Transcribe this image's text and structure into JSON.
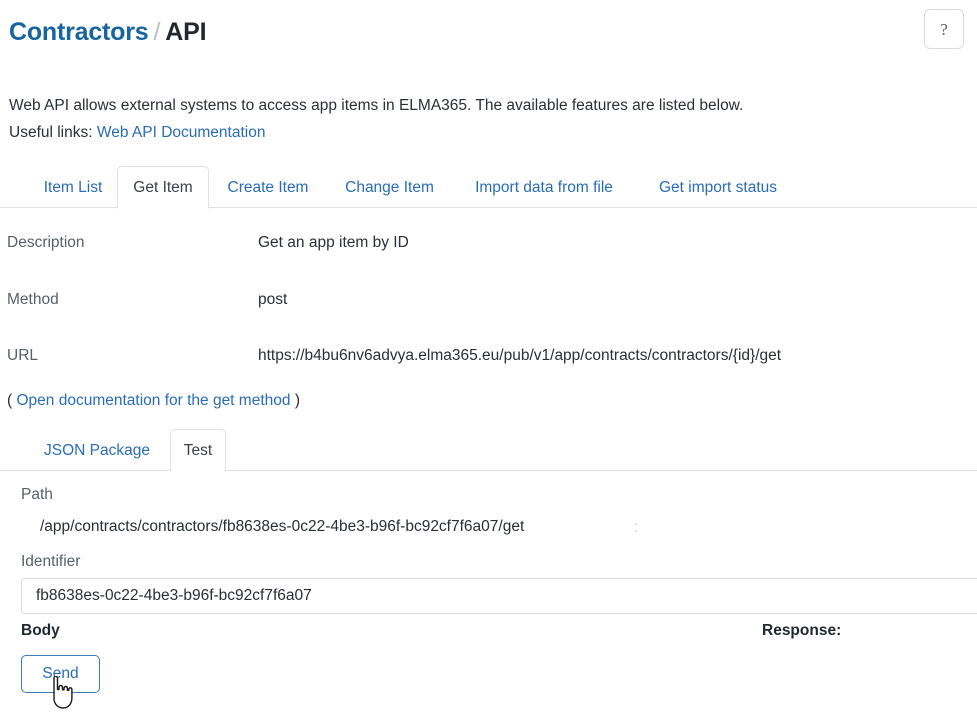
{
  "header": {
    "breadcrumb_parent": "Contractors",
    "breadcrumb_separator": "/",
    "breadcrumb_current": "API",
    "help_glyph": "?"
  },
  "intro": {
    "line1": "Web API allows external systems to access app items in ELMA365. The available features are listed below.",
    "line2_prefix": "Useful links: ",
    "line2_link": "Web API Documentation"
  },
  "primary_tabs": [
    {
      "label": "Item List",
      "active": false
    },
    {
      "label": "Get Item",
      "active": true
    },
    {
      "label": "Create Item",
      "active": false
    },
    {
      "label": "Change Item",
      "active": false
    },
    {
      "label": "Import data from file",
      "active": false
    },
    {
      "label": "Get import status",
      "active": false
    }
  ],
  "details": [
    {
      "label": "Description",
      "value": "Get an app item by ID"
    },
    {
      "label": "Method",
      "value": "post"
    },
    {
      "label": "URL",
      "value": "https://b4bu6nv6advya.elma365.eu/pub/v1/app/contracts/contractors/{id}/get"
    }
  ],
  "doc_link": {
    "open_paren": "(",
    "link": "Open documentation for the get method",
    "close_paren": ")"
  },
  "secondary_tabs": [
    {
      "label": "JSON Package",
      "active": false
    },
    {
      "label": "Test",
      "active": true
    }
  ],
  "test_panel": {
    "path_label": "Path",
    "path_value": "/app/contracts/contractors/fb8638es-0c22-4be3-b96f-bc92cf7f6a07/get",
    "path_dots": ":",
    "identifier_label": "Identifier",
    "identifier_value": "fb8638es-0c22-4be3-b96f-bc92cf7f6a07",
    "identifier_placeholder": "",
    "body_label": "Body",
    "response_label": "Response:",
    "send_label": "Send"
  },
  "colors": {
    "link": "#2b6cb8",
    "breadcrumb_link": "#16659e",
    "text": "#2a2f36",
    "muted": "#585f68",
    "border": "#dfe2e6",
    "button_border": "#3b7cbe"
  }
}
